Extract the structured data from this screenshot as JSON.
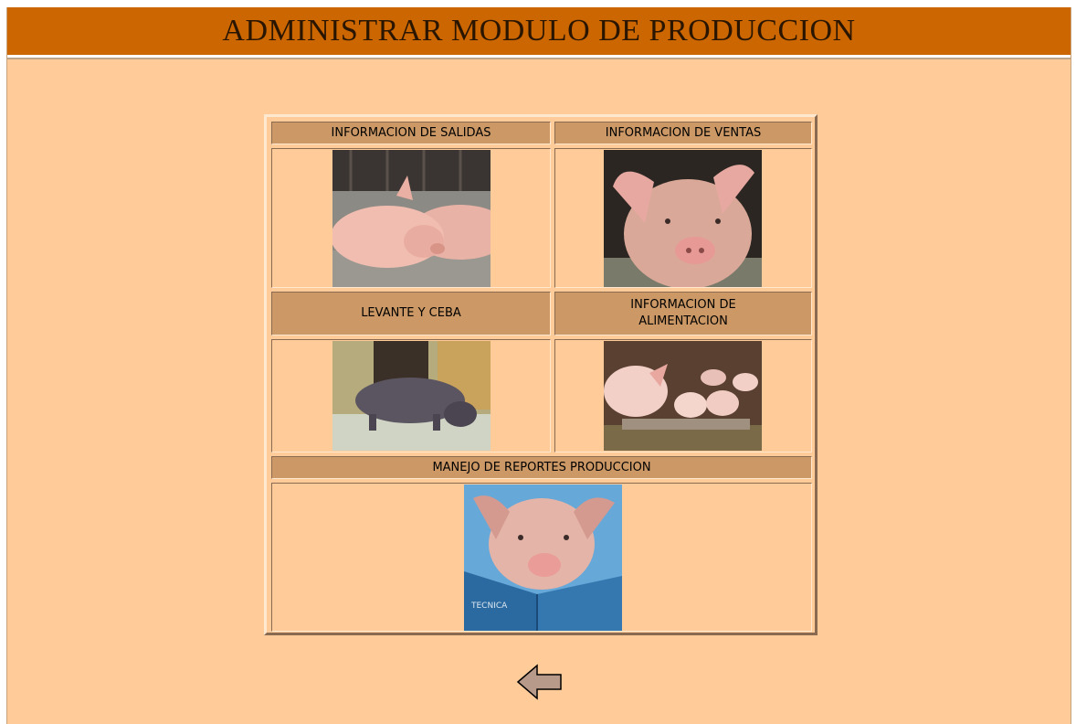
{
  "header": {
    "title": "ADMINISTRAR MODULO DE PRODUCCION"
  },
  "menu": {
    "salidas": {
      "label": "INFORMACION DE SALIDAS"
    },
    "ventas": {
      "label": "INFORMACION DE VENTAS"
    },
    "levante": {
      "label": "LEVANTE Y CEBA"
    },
    "alimentacion": {
      "label_line1": "INFORMACION DE",
      "label_line2": "ALIMENTACION"
    },
    "reportes": {
      "label": "MANEJO DE REPORTES PRODUCCION",
      "book_text": "TECNICA"
    }
  },
  "colors": {
    "background": "#ffcc99",
    "header": "#cc6600",
    "label": "#cc9966"
  },
  "icons": {
    "back": "left-arrow-icon"
  }
}
